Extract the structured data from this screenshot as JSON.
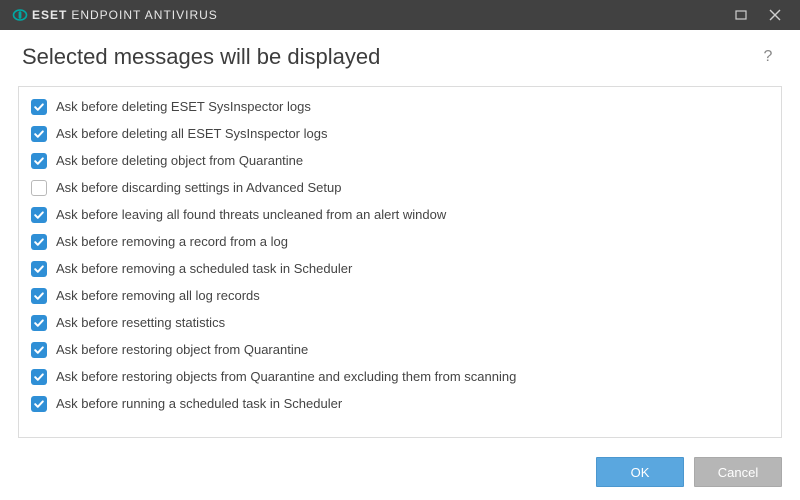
{
  "titlebar": {
    "brand": "ESET",
    "product": "ENDPOINT ANTIVIRUS"
  },
  "heading": "Selected messages will be displayed",
  "help_symbol": "?",
  "items": [
    {
      "label": "Ask before deleting ESET SysInspector logs",
      "checked": true
    },
    {
      "label": "Ask before deleting all ESET SysInspector logs",
      "checked": true
    },
    {
      "label": "Ask before deleting object from Quarantine",
      "checked": true
    },
    {
      "label": "Ask before discarding settings in Advanced Setup",
      "checked": false
    },
    {
      "label": "Ask before leaving all found threats uncleaned from an alert window",
      "checked": true
    },
    {
      "label": "Ask before removing a record from a log",
      "checked": true
    },
    {
      "label": "Ask before removing a scheduled task in Scheduler",
      "checked": true
    },
    {
      "label": "Ask before removing all log records",
      "checked": true
    },
    {
      "label": "Ask before resetting statistics",
      "checked": true
    },
    {
      "label": "Ask before restoring object from Quarantine",
      "checked": true
    },
    {
      "label": "Ask before restoring objects from Quarantine and excluding them from scanning",
      "checked": true
    },
    {
      "label": "Ask before running a scheduled task in Scheduler",
      "checked": true
    }
  ],
  "footer": {
    "ok_label": "OK",
    "cancel_label": "Cancel"
  },
  "colors": {
    "accent": "#2f8fd6",
    "titlebar_bg": "#414141",
    "primary_btn": "#5aa7df",
    "secondary_btn": "#b6b6b6"
  }
}
